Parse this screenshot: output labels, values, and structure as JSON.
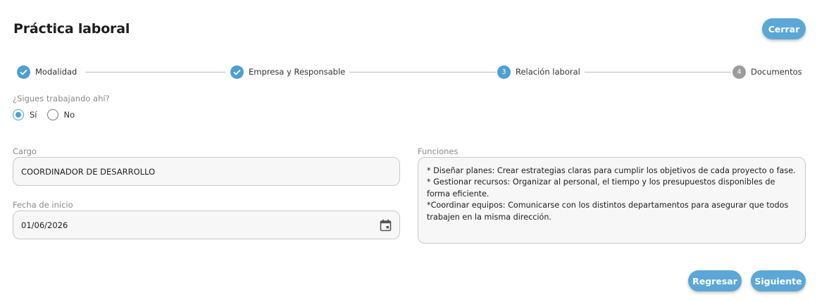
{
  "header": {
    "title": "Práctica laboral",
    "close_label": "Cerrar"
  },
  "stepper": {
    "steps": [
      {
        "number": "1",
        "label": "Modalidad",
        "status": "done"
      },
      {
        "number": "2",
        "label": "Empresa y Responsable",
        "status": "done"
      },
      {
        "number": "3",
        "label": "Relación laboral",
        "status": "active"
      },
      {
        "number": "4",
        "label": "Documentos",
        "status": "pending"
      }
    ]
  },
  "question": {
    "label": "¿Sigues trabajando ahí?",
    "options": [
      {
        "label": "Sí",
        "checked": true
      },
      {
        "label": "No",
        "checked": false
      }
    ]
  },
  "form": {
    "cargo_label": "Cargo",
    "cargo_value": "COORDINADOR DE DESARROLLO",
    "fecha_label": "Fecha de inicio",
    "fecha_value": "01/06/2026",
    "funciones_label": "Funciones",
    "funciones_lines": [
      "* Diseñar planes: Crear estrategias claras para cumplir los objetivos de cada proyecto o fase.",
      "* Gestionar recursos: Organizar al personal, el tiempo y los presupuestos disponibles de forma eficiente.",
      "*Coordinar equipos: Comunicarse con los distintos departamentos para asegurar que todos trabajen en la misma dirección."
    ]
  },
  "footer": {
    "back_label": "Regresar",
    "next_label": "Siguiente"
  },
  "colors": {
    "accent": "#4f9fd0",
    "button": "#5ba7d6",
    "pending": "#9c9c9c"
  },
  "icons": {
    "done": "check-icon",
    "date": "calendar-icon"
  }
}
